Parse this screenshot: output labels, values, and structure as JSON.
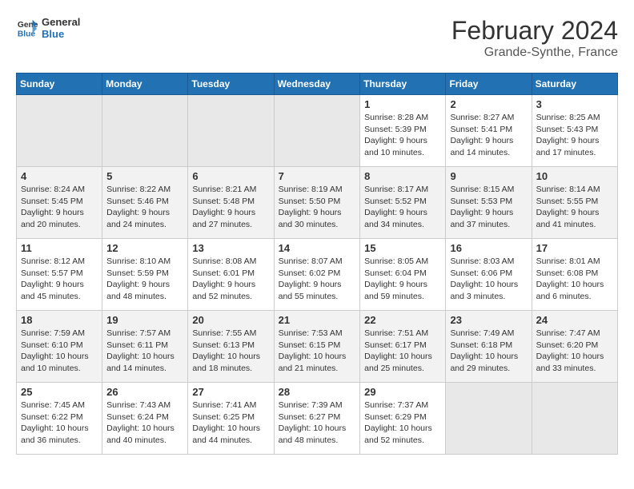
{
  "header": {
    "logo_line1": "General",
    "logo_line2": "Blue",
    "title": "February 2024",
    "subtitle": "Grande-Synthe, France"
  },
  "days_of_week": [
    "Sunday",
    "Monday",
    "Tuesday",
    "Wednesday",
    "Thursday",
    "Friday",
    "Saturday"
  ],
  "weeks": [
    [
      {
        "num": "",
        "info": ""
      },
      {
        "num": "",
        "info": ""
      },
      {
        "num": "",
        "info": ""
      },
      {
        "num": "",
        "info": ""
      },
      {
        "num": "1",
        "info": "Sunrise: 8:28 AM\nSunset: 5:39 PM\nDaylight: 9 hours\nand 10 minutes."
      },
      {
        "num": "2",
        "info": "Sunrise: 8:27 AM\nSunset: 5:41 PM\nDaylight: 9 hours\nand 14 minutes."
      },
      {
        "num": "3",
        "info": "Sunrise: 8:25 AM\nSunset: 5:43 PM\nDaylight: 9 hours\nand 17 minutes."
      }
    ],
    [
      {
        "num": "4",
        "info": "Sunrise: 8:24 AM\nSunset: 5:45 PM\nDaylight: 9 hours\nand 20 minutes."
      },
      {
        "num": "5",
        "info": "Sunrise: 8:22 AM\nSunset: 5:46 PM\nDaylight: 9 hours\nand 24 minutes."
      },
      {
        "num": "6",
        "info": "Sunrise: 8:21 AM\nSunset: 5:48 PM\nDaylight: 9 hours\nand 27 minutes."
      },
      {
        "num": "7",
        "info": "Sunrise: 8:19 AM\nSunset: 5:50 PM\nDaylight: 9 hours\nand 30 minutes."
      },
      {
        "num": "8",
        "info": "Sunrise: 8:17 AM\nSunset: 5:52 PM\nDaylight: 9 hours\nand 34 minutes."
      },
      {
        "num": "9",
        "info": "Sunrise: 8:15 AM\nSunset: 5:53 PM\nDaylight: 9 hours\nand 37 minutes."
      },
      {
        "num": "10",
        "info": "Sunrise: 8:14 AM\nSunset: 5:55 PM\nDaylight: 9 hours\nand 41 minutes."
      }
    ],
    [
      {
        "num": "11",
        "info": "Sunrise: 8:12 AM\nSunset: 5:57 PM\nDaylight: 9 hours\nand 45 minutes."
      },
      {
        "num": "12",
        "info": "Sunrise: 8:10 AM\nSunset: 5:59 PM\nDaylight: 9 hours\nand 48 minutes."
      },
      {
        "num": "13",
        "info": "Sunrise: 8:08 AM\nSunset: 6:01 PM\nDaylight: 9 hours\nand 52 minutes."
      },
      {
        "num": "14",
        "info": "Sunrise: 8:07 AM\nSunset: 6:02 PM\nDaylight: 9 hours\nand 55 minutes."
      },
      {
        "num": "15",
        "info": "Sunrise: 8:05 AM\nSunset: 6:04 PM\nDaylight: 9 hours\nand 59 minutes."
      },
      {
        "num": "16",
        "info": "Sunrise: 8:03 AM\nSunset: 6:06 PM\nDaylight: 10 hours\nand 3 minutes."
      },
      {
        "num": "17",
        "info": "Sunrise: 8:01 AM\nSunset: 6:08 PM\nDaylight: 10 hours\nand 6 minutes."
      }
    ],
    [
      {
        "num": "18",
        "info": "Sunrise: 7:59 AM\nSunset: 6:10 PM\nDaylight: 10 hours\nand 10 minutes."
      },
      {
        "num": "19",
        "info": "Sunrise: 7:57 AM\nSunset: 6:11 PM\nDaylight: 10 hours\nand 14 minutes."
      },
      {
        "num": "20",
        "info": "Sunrise: 7:55 AM\nSunset: 6:13 PM\nDaylight: 10 hours\nand 18 minutes."
      },
      {
        "num": "21",
        "info": "Sunrise: 7:53 AM\nSunset: 6:15 PM\nDaylight: 10 hours\nand 21 minutes."
      },
      {
        "num": "22",
        "info": "Sunrise: 7:51 AM\nSunset: 6:17 PM\nDaylight: 10 hours\nand 25 minutes."
      },
      {
        "num": "23",
        "info": "Sunrise: 7:49 AM\nSunset: 6:18 PM\nDaylight: 10 hours\nand 29 minutes."
      },
      {
        "num": "24",
        "info": "Sunrise: 7:47 AM\nSunset: 6:20 PM\nDaylight: 10 hours\nand 33 minutes."
      }
    ],
    [
      {
        "num": "25",
        "info": "Sunrise: 7:45 AM\nSunset: 6:22 PM\nDaylight: 10 hours\nand 36 minutes."
      },
      {
        "num": "26",
        "info": "Sunrise: 7:43 AM\nSunset: 6:24 PM\nDaylight: 10 hours\nand 40 minutes."
      },
      {
        "num": "27",
        "info": "Sunrise: 7:41 AM\nSunset: 6:25 PM\nDaylight: 10 hours\nand 44 minutes."
      },
      {
        "num": "28",
        "info": "Sunrise: 7:39 AM\nSunset: 6:27 PM\nDaylight: 10 hours\nand 48 minutes."
      },
      {
        "num": "29",
        "info": "Sunrise: 7:37 AM\nSunset: 6:29 PM\nDaylight: 10 hours\nand 52 minutes."
      },
      {
        "num": "",
        "info": ""
      },
      {
        "num": "",
        "info": ""
      }
    ]
  ]
}
